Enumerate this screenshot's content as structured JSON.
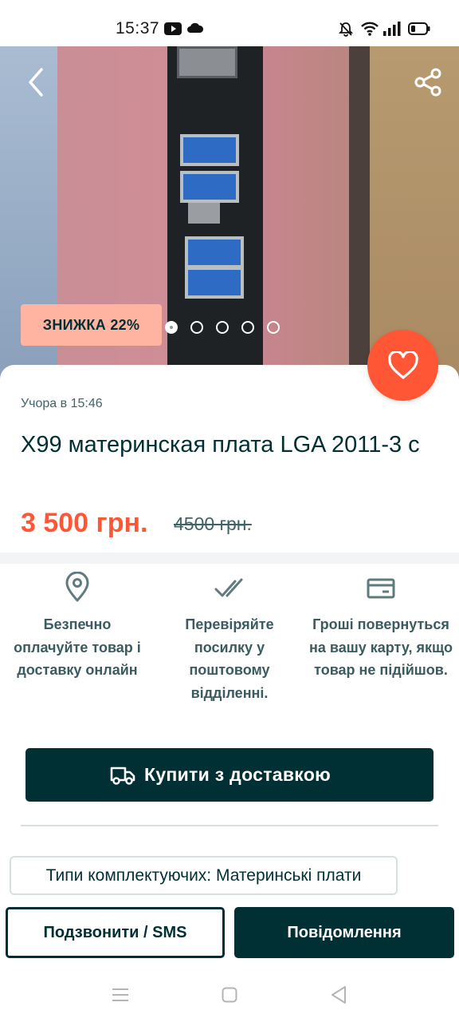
{
  "status_bar": {
    "time": "15:37",
    "icons": [
      "youtube-icon",
      "cloud-icon",
      "bell-off-icon",
      "wifi-icon",
      "signal-icon",
      "battery-icon"
    ]
  },
  "gallery": {
    "discount_badge": "ЗНИЖКА 22%",
    "dot_count": 5,
    "active_dot": 1
  },
  "listing": {
    "posted": "Учора в 15:46",
    "title": "X99 материнская плата LGA 2011-3 с",
    "price": "3 500 грн.",
    "old_price": "4500 грн."
  },
  "features": [
    {
      "icon": "location-pin-icon",
      "text": "Безпечно оплачуйте товар і доставку онлайн"
    },
    {
      "icon": "double-check-icon",
      "text": "Перевіряйте посилку у поштовому відділенні."
    },
    {
      "icon": "card-icon",
      "text": "Гроші повернуться на вашу карту, якщо товар не підійшов."
    }
  ],
  "buy_button": {
    "label": "Купити з доставкою",
    "icon": "truck-icon"
  },
  "tag": {
    "label": "Типи комплектуючих: Материнські плати"
  },
  "actions": {
    "call_label": "Подзвонити / SMS",
    "message_label": "Повідомлення"
  },
  "colors": {
    "accent": "#ff5636",
    "primary": "#002f34",
    "badge": "#ffb3a1"
  }
}
